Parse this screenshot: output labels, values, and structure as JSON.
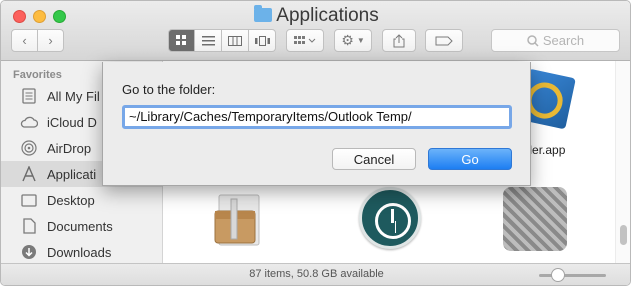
{
  "window": {
    "title": "Applications",
    "title_icon": "folder-icon"
  },
  "toolbar": {
    "back_icon": "‹",
    "forward_icon": "›",
    "search_placeholder": "Search",
    "view_modes": [
      "icon",
      "list",
      "column",
      "cover-flow"
    ],
    "selected_view": "icon"
  },
  "sidebar": {
    "heading": "Favorites",
    "items": [
      {
        "label": "All My Fil",
        "icon": "all-files-icon"
      },
      {
        "label": "iCloud D",
        "icon": "icloud-icon"
      },
      {
        "label": "AirDrop",
        "icon": "airdrop-icon"
      },
      {
        "label": "Applicati",
        "icon": "applications-icon",
        "selected": true
      },
      {
        "label": "Desktop",
        "icon": "desktop-icon"
      },
      {
        "label": "Documents",
        "icon": "documents-icon"
      },
      {
        "label": "Downloads",
        "icon": "downloads-icon"
      }
    ]
  },
  "content": {
    "visible_label_fragment": "ngler.app"
  },
  "statusbar": {
    "text": "87 items, 50.8 GB available"
  },
  "dialog": {
    "label": "Go to the folder:",
    "input_value": "~/Library/Caches/TemporaryItems/Outlook Temp/",
    "cancel_label": "Cancel",
    "go_label": "Go"
  },
  "colors": {
    "accent": "#1d7ef2",
    "focus_ring": "#77a7e8",
    "selected_sidebar": "#dadada"
  }
}
